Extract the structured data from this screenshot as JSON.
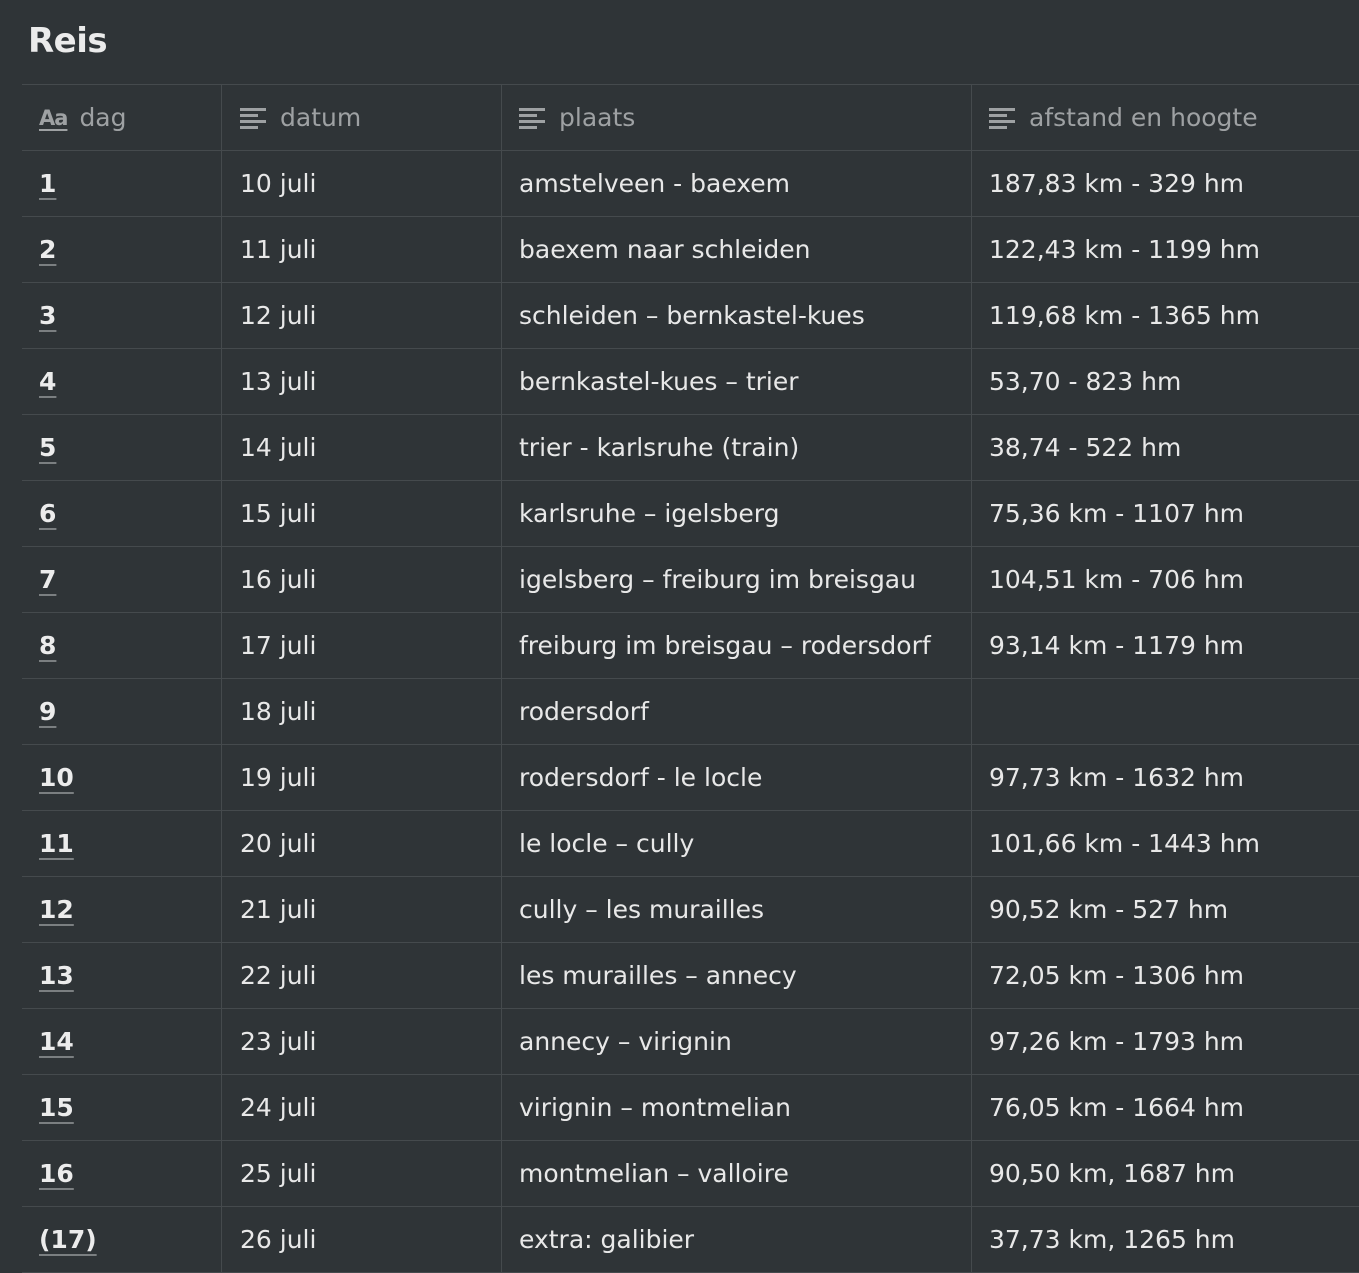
{
  "title": "Reis",
  "columns": {
    "dag": {
      "label": "dag",
      "icon": "title-property-icon"
    },
    "datum": {
      "label": "datum",
      "icon": "text-property-icon"
    },
    "plaats": {
      "label": "plaats",
      "icon": "text-property-icon"
    },
    "afstand": {
      "label": "afstand en hoogte",
      "icon": "text-property-icon"
    }
  },
  "rows": [
    {
      "dag": "1",
      "datum": "10 juli",
      "plaats": "amstelveen - baexem",
      "afstand": "187,83 km - 329 hm"
    },
    {
      "dag": "2",
      "datum": "11 juli",
      "plaats": "baexem naar schleiden",
      "afstand": "122,43 km - 1199 hm"
    },
    {
      "dag": "3",
      "datum": "12 juli",
      "plaats": "schleiden – bernkastel-kues",
      "afstand": "119,68 km - 1365 hm"
    },
    {
      "dag": "4",
      "datum": "13 juli",
      "plaats": "bernkastel-kues – trier",
      "afstand": "53,70 - 823 hm"
    },
    {
      "dag": "5",
      "datum": "14 juli",
      "plaats": "trier - karlsruhe (train)",
      "afstand": "38,74 - 522 hm"
    },
    {
      "dag": "6",
      "datum": "15 juli",
      "plaats": "karlsruhe – igelsberg",
      "afstand": "75,36 km - 1107 hm"
    },
    {
      "dag": "7",
      "datum": "16 juli",
      "plaats": "igelsberg – freiburg im breisgau",
      "afstand": "104,51 km - 706 hm"
    },
    {
      "dag": "8",
      "datum": "17 juli",
      "plaats": "freiburg im breisgau – rodersdorf",
      "afstand": "93,14 km - 1179 hm"
    },
    {
      "dag": "9",
      "datum": "18 juli",
      "plaats": "rodersdorf",
      "afstand": ""
    },
    {
      "dag": "10",
      "datum": "19 juli",
      "plaats": "rodersdorf - le locle",
      "afstand": "97,73 km - 1632 hm"
    },
    {
      "dag": "11",
      "datum": "20 juli",
      "plaats": "le locle – cully",
      "afstand": "101,66 km - 1443 hm"
    },
    {
      "dag": "12",
      "datum": "21 juli",
      "plaats": "cully – les murailles",
      "afstand": "90,52 km - 527 hm"
    },
    {
      "dag": "13",
      "datum": "22 juli",
      "plaats": "les murailles – annecy",
      "afstand": "72,05 km - 1306 hm"
    },
    {
      "dag": "14",
      "datum": "23 juli",
      "plaats": "annecy – virignin",
      "afstand": "97,26 km - 1793 hm"
    },
    {
      "dag": "15",
      "datum": "24 juli",
      "plaats": "virignin – montmelian",
      "afstand": "76,05 km - 1664 hm"
    },
    {
      "dag": "16",
      "datum": "25 juli",
      "plaats": "montmelian – valloire",
      "afstand": "90,50 km, 1687 hm"
    },
    {
      "dag": "(17)",
      "datum": "26 juli",
      "plaats": "extra: galibier",
      "afstand": "37,73 km, 1265 hm"
    }
  ]
}
